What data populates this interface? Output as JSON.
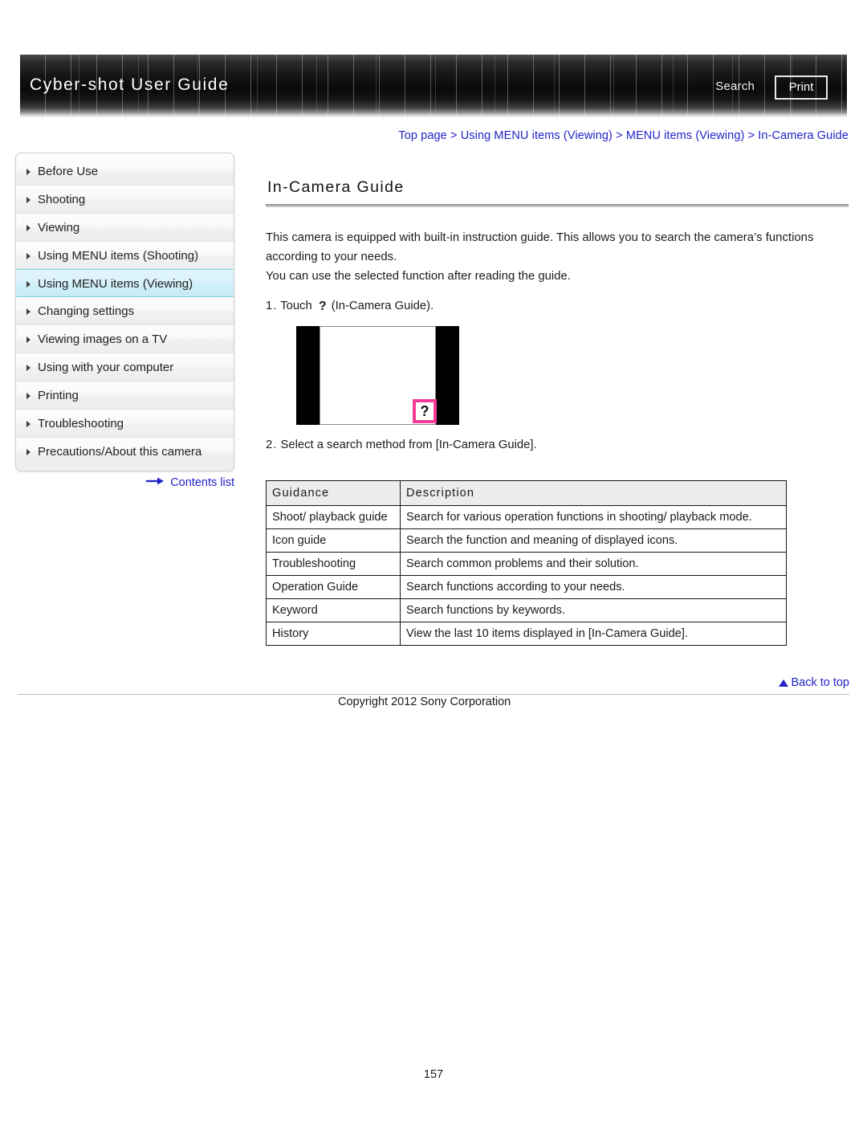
{
  "header": {
    "title": "Cyber-shot User Guide",
    "search_label": "Search",
    "print_label": "Print"
  },
  "breadcrumb": {
    "items": [
      "Top page",
      "Using MENU items (Viewing)",
      "MENU items (Viewing)",
      "In-Camera Guide"
    ],
    "separator": ">",
    "full_text": "Top page > Using MENU items (Viewing) > MENU items (Viewing) > In-Camera Guide",
    "color": "#2323c8"
  },
  "sidebar": {
    "items": [
      {
        "label": "Before Use",
        "selected": false
      },
      {
        "label": "Shooting",
        "selected": false
      },
      {
        "label": "Viewing",
        "selected": false
      },
      {
        "label": "Using MENU items (Shooting)",
        "selected": false
      },
      {
        "label": "Using MENU items (Viewing)",
        "selected": true
      },
      {
        "label": "Changing settings",
        "selected": false
      },
      {
        "label": "Viewing images on a TV",
        "selected": false
      },
      {
        "label": "Using with your computer",
        "selected": false
      },
      {
        "label": "Printing",
        "selected": false
      },
      {
        "label": "Troubleshooting",
        "selected": false
      },
      {
        "label": "Precautions/About this camera",
        "selected": false
      }
    ],
    "contents_list_label": "Contents list",
    "selected_bg": "#d5f0f9"
  },
  "main": {
    "title": "In-Camera Guide",
    "paragraph_line1": "This camera is equipped with built-in instruction guide. This allows you to search the camera’s functions",
    "paragraph_line2": "according to your needs.",
    "paragraph_line3": "You can use the selected function after reading the guide.",
    "step1_num": "1.",
    "step1_pre": "Touch",
    "step1_icon": "?",
    "step1_post": "(In-Camera Guide).",
    "step2_num": "2.",
    "step2_text": "Select a search method from [In-Camera Guide].",
    "figure": {
      "icon_glyph": "?",
      "highlight_color": "#f73a9a"
    },
    "table": {
      "headers": [
        "Guidance",
        "Description"
      ],
      "rows": [
        [
          "Shoot/ playback guide",
          "Search for various operation functions in shooting/ playback mode."
        ],
        [
          "Icon guide",
          "Search the function and meaning of displayed icons."
        ],
        [
          "Troubleshooting",
          "Search common problems and their solution."
        ],
        [
          "Operation Guide",
          "Search functions according to your needs."
        ],
        [
          "Keyword",
          "Search functions by keywords."
        ],
        [
          "History",
          "View the last 10 items displayed in [In-Camera Guide]."
        ]
      ]
    }
  },
  "footer": {
    "back_to_top_label": "Back to top",
    "copyright": "Copyright 2012 Sony Corporation",
    "page_number": "157"
  }
}
